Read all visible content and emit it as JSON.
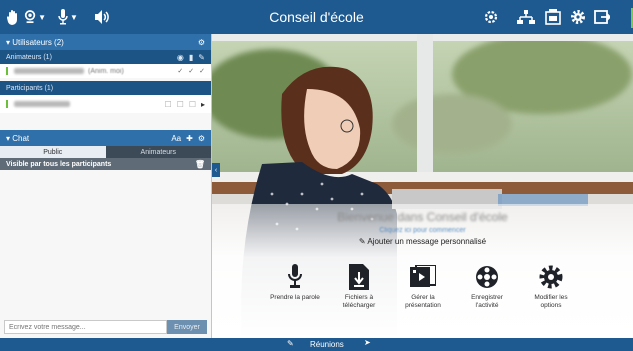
{
  "header": {
    "title": "Conseil d'école"
  },
  "sidebar": {
    "users_section": "Utilisateurs (2)",
    "animators_header": "Animateurs (1)",
    "animator_user_suffix": "(Anim. moi)",
    "participants_header": "Participants (1)",
    "chat_section": "Chat",
    "chat_tabs": [
      "Public",
      "Animateurs"
    ],
    "visible_label": "Visible par tous les participants",
    "message_placeholder": "Écrivez votre message...",
    "send_label": "Envoyer"
  },
  "welcome": {
    "title": "Bienvenue dans Conseil d'école",
    "sublink": "Cliquez ici pour commencer",
    "custom_message": "Ajouter un message personnalisé"
  },
  "actions": [
    {
      "label": "Prendre la parole",
      "icon": "microphone-icon"
    },
    {
      "label": "Fichiers à télécharger",
      "icon": "download-file-icon"
    },
    {
      "label": "Gérer la présentation",
      "icon": "presentation-icon"
    },
    {
      "label": "Enregistrer l'activité",
      "icon": "record-reel-icon"
    },
    {
      "label": "Modifier les options",
      "icon": "gear-icon"
    }
  ],
  "bottom": {
    "label": "Réunions"
  },
  "colors": {
    "header": "#1e5a8f",
    "section": "#2f70ab",
    "subsection": "#1d5486",
    "status_green": "#6bbf3a"
  }
}
